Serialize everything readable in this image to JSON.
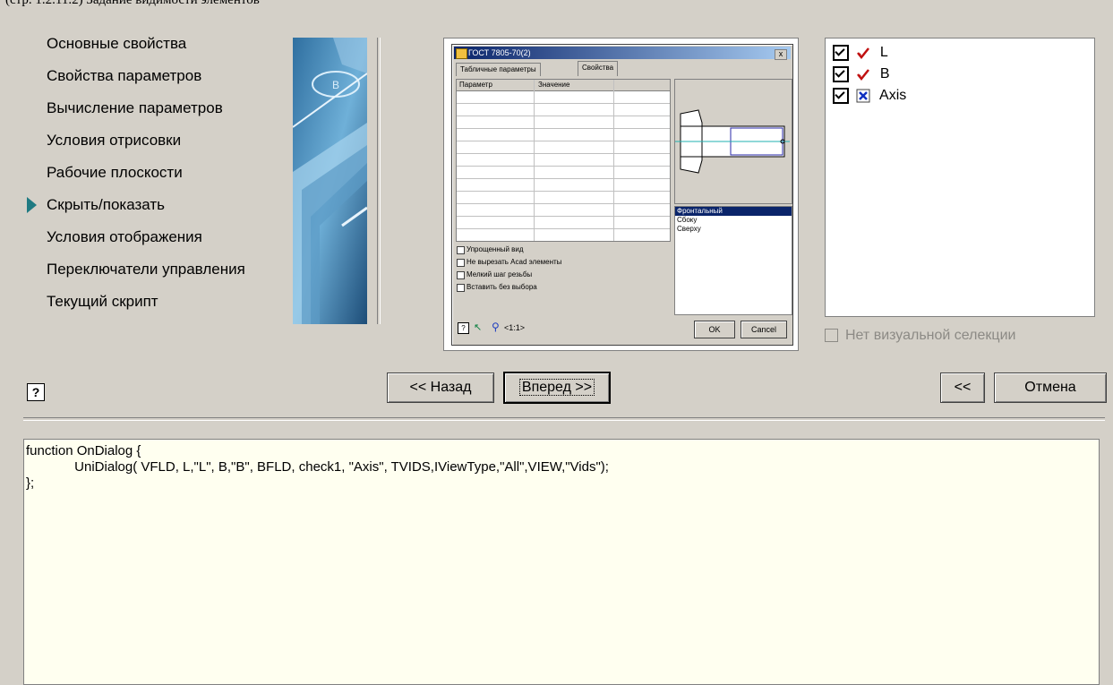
{
  "caption": "(стр. 1.2.11.2) Задание видимости элементов",
  "nav": {
    "items": [
      {
        "label": "Основные свойства",
        "active": false
      },
      {
        "label": "Свойства параметров",
        "active": false
      },
      {
        "label": "Вычисление параметров",
        "active": false
      },
      {
        "label": "Условия отрисовки",
        "active": false
      },
      {
        "label": "Рабочие плоскости",
        "active": false
      },
      {
        "label": "Скрыть/показать",
        "active": true
      },
      {
        "label": "Условия отображения",
        "active": false
      },
      {
        "label": "Переключатели управления",
        "active": false
      },
      {
        "label": "Текущий скрипт",
        "active": false
      }
    ]
  },
  "preview": {
    "title": "ГОСТ 7805-70(2)",
    "close": "x",
    "tabs": [
      "Табличные параметры",
      "Свойства"
    ],
    "columns": [
      "Параметр",
      "Значение"
    ],
    "views": [
      "Фронтальный",
      "Сбоку",
      "Сверху"
    ],
    "selected_view": "Фронтальный",
    "checks": [
      "Упрощенный вид",
      "Не вырезать Acad элементы",
      "Мелкий шаг резьбы",
      "Вставить без выбора"
    ],
    "scale": "<1:1>",
    "ok": "OK",
    "cancel": "Cancel"
  },
  "checklist": {
    "items": [
      {
        "label": "L",
        "checked": true,
        "icon": "dimension-icon"
      },
      {
        "label": "B",
        "checked": true,
        "icon": "dimension-icon"
      },
      {
        "label": "Axis",
        "checked": true,
        "icon": "blue-x-icon"
      }
    ]
  },
  "no_visual_selection": "Нет визуальной селекции",
  "buttons": {
    "back": "<< Назад",
    "next": "Вперед >>",
    "collapse": "<<",
    "cancel": "Отмена"
  },
  "help_label": "?",
  "code": {
    "lines": [
      "function OnDialog {",
      "             UniDialog( VFLD, L,\"L\", B,\"B\", BFLD, check1, \"Axis\", TVIDS,IViewType,\"All\",VIEW,\"Vids\");",
      "};"
    ]
  },
  "colors": {
    "dialog_bg": "#d4d0c8",
    "active_arrow": "#1f7a82",
    "editor_bg": "#fffff0",
    "disabled_text": "#8c8a85",
    "selection": "#0a246a"
  }
}
